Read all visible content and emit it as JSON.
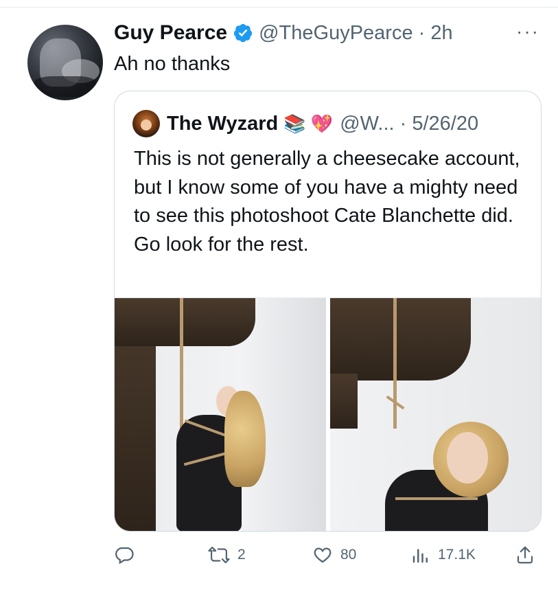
{
  "tweet": {
    "author_name": "Guy Pearce",
    "author_handle_time": "@TheGuyPearce · 2h",
    "text": "Ah no thanks",
    "more_label": "···"
  },
  "quote": {
    "author_name": "The Wyzard",
    "emojis": "📚 💖",
    "handle_date": "@W... · 5/26/20",
    "text": "This is not generally a cheesecake account, but I know some of you have a mighty need to see this photoshoot Cate Blanchette did. Go look for the rest."
  },
  "actions": {
    "reply_count": "",
    "retweet_count": "2",
    "like_count": "80",
    "views_count": "17.1K"
  },
  "icons": [
    "verified-badge-icon",
    "more-icon",
    "reply-icon",
    "retweet-icon",
    "like-icon",
    "views-icon",
    "share-icon"
  ],
  "colors": {
    "verified": "#1d9bf0",
    "secondary_text": "#536471",
    "primary_text": "#0f1419",
    "border": "#cfd9de"
  }
}
